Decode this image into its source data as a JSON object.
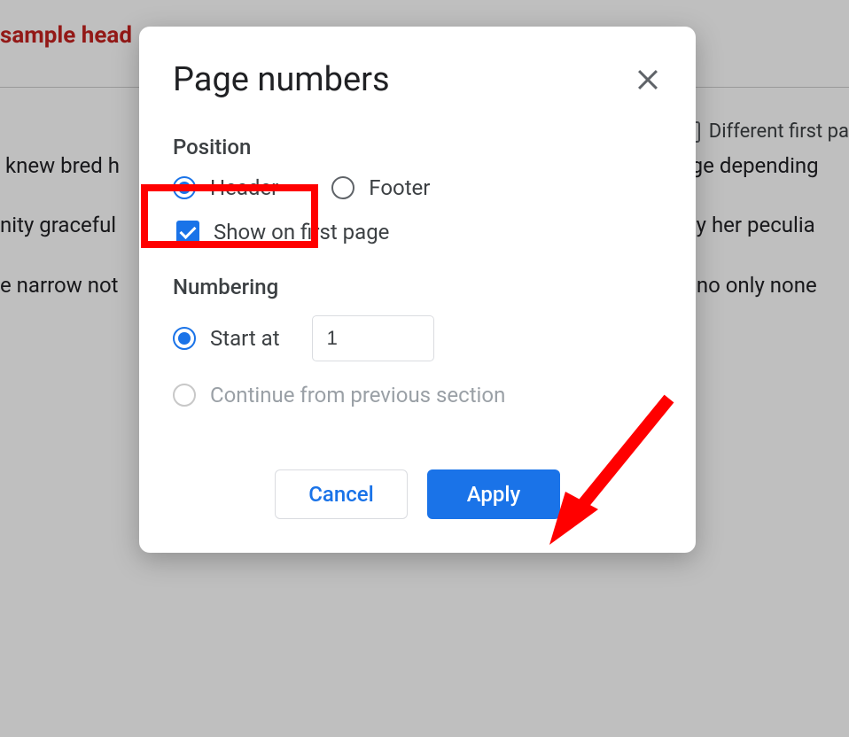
{
  "background": {
    "sample_header": "sample head",
    "different_first_page_label": "Different first pa",
    "paragraph1": " knew bred h                                                                                admire wisdo  age depending                                                                               . An fail up so  ise in. Minute                                                                                 oh in no death  ntented direc                                                                                  rrars few arriva  not charmed                                                                               f years in mor",
    "paragraph2": "nity graceful                                                                                   y building not   y her peculia                                                                                  ceptance to so  e appearance                                                                                 d. Pursuit   perhaps all.",
    "paragraph3": "e narrow not                                                                                   mrs led certai  no only none                                                                                  road am depar  hearts as me                                                                                  upposing man  ies goodness                                                                                  mode sir  northward immediate eat. Man denoting received you sex possible you. Shew park  on door less yet."
  },
  "dialog": {
    "title": "Page numbers",
    "position": {
      "section_label": "Position",
      "header_label": "Header",
      "footer_label": "Footer",
      "show_on_first_page_label": "Show on first page"
    },
    "numbering": {
      "section_label": "Numbering",
      "start_at_label": "Start at",
      "start_at_value": "1",
      "continue_label": "Continue from previous section"
    },
    "buttons": {
      "cancel": "Cancel",
      "apply": "Apply"
    }
  }
}
